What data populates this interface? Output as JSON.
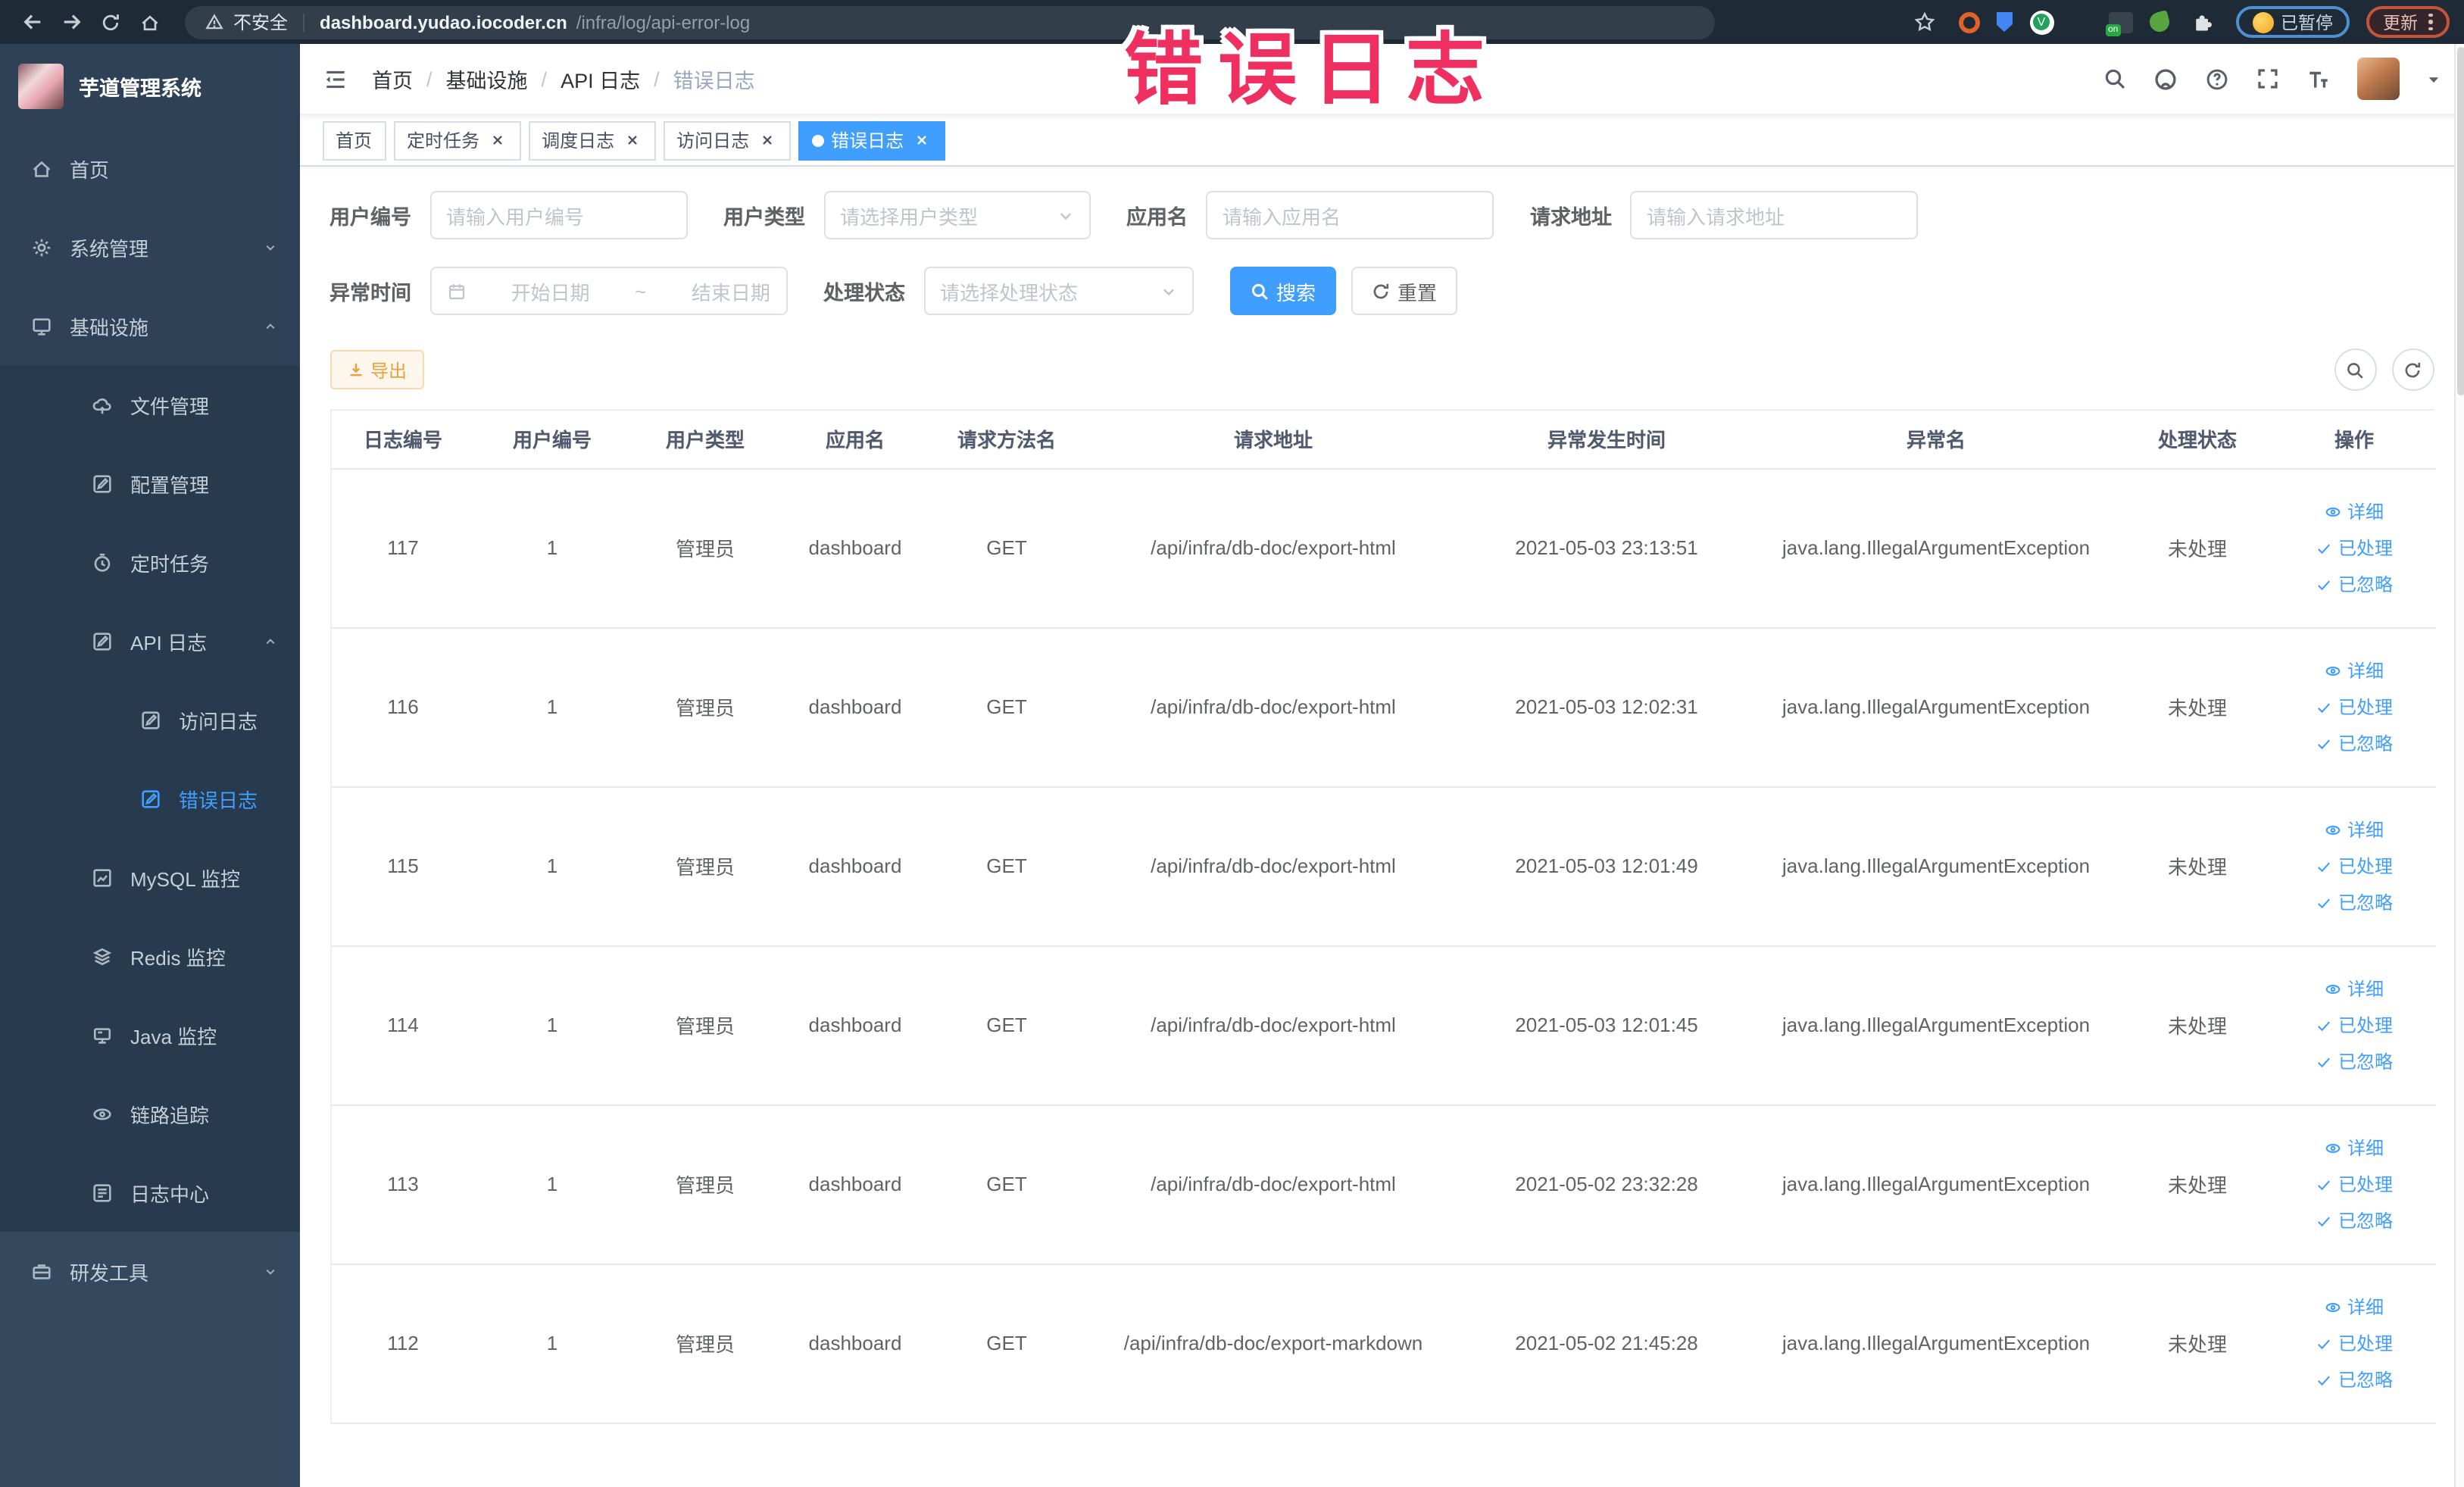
{
  "browser": {
    "security_label": "不安全",
    "url_host": "dashboard.yudao.iocoder.cn",
    "url_path": "/infra/log/api-error-log",
    "paused_label": "已暂停",
    "update_label": "更新"
  },
  "annotation": {
    "text": "错误日志",
    "color": "#ee2f5f"
  },
  "sidebar": {
    "logo_title": "芋道管理系统",
    "menu": [
      {
        "label": "首页",
        "icon": "home",
        "level": 1,
        "section": "top"
      },
      {
        "label": "系统管理",
        "icon": "gear",
        "level": 1,
        "section": "top",
        "chevron": "down"
      },
      {
        "label": "基础设施",
        "icon": "monitor",
        "level": 1,
        "section": "top",
        "chevron": "up"
      },
      {
        "label": "文件管理",
        "icon": "cloud",
        "level": 2,
        "section": "sub"
      },
      {
        "label": "配置管理",
        "icon": "edit",
        "level": 2,
        "section": "sub"
      },
      {
        "label": "定时任务",
        "icon": "timer",
        "level": 2,
        "section": "sub"
      },
      {
        "label": "API 日志",
        "icon": "edit",
        "level": 2,
        "section": "sub",
        "chevron": "up"
      },
      {
        "label": "访问日志",
        "icon": "edit",
        "level": 3,
        "section": "sub"
      },
      {
        "label": "错误日志",
        "icon": "edit",
        "level": 3,
        "section": "sub",
        "active": true
      },
      {
        "label": "MySQL 监控",
        "icon": "chart",
        "level": 2,
        "section": "sub"
      },
      {
        "label": "Redis 监控",
        "icon": "layers",
        "level": 2,
        "section": "sub"
      },
      {
        "label": "Java 监控",
        "icon": "java",
        "level": 2,
        "section": "sub"
      },
      {
        "label": "链路追踪",
        "icon": "eye",
        "level": 2,
        "section": "sub"
      },
      {
        "label": "日志中心",
        "icon": "doc",
        "level": 2,
        "section": "sub"
      },
      {
        "label": "研发工具",
        "icon": "tools",
        "level": 1,
        "section": "bottom",
        "chevron": "down"
      }
    ]
  },
  "breadcrumb": {
    "items": [
      "首页",
      "基础设施",
      "API 日志"
    ],
    "current": "错误日志"
  },
  "tabs": [
    {
      "label": "首页",
      "closable": false,
      "active": false
    },
    {
      "label": "定时任务",
      "closable": true,
      "active": false
    },
    {
      "label": "调度日志",
      "closable": true,
      "active": false
    },
    {
      "label": "访问日志",
      "closable": true,
      "active": false
    },
    {
      "label": "错误日志",
      "closable": true,
      "active": true
    }
  ],
  "filters": {
    "user_id": {
      "label": "用户编号",
      "placeholder": "请输入用户编号"
    },
    "user_type": {
      "label": "用户类型",
      "placeholder": "请选择用户类型"
    },
    "app_name": {
      "label": "应用名",
      "placeholder": "请输入应用名"
    },
    "request_url": {
      "label": "请求地址",
      "placeholder": "请输入请求地址"
    },
    "exception_time": {
      "label": "异常时间",
      "start_placeholder": "开始日期",
      "separator": "~",
      "end_placeholder": "结束日期"
    },
    "process_status": {
      "label": "处理状态",
      "placeholder": "请选择处理状态"
    },
    "search_label": "搜索",
    "reset_label": "重置"
  },
  "toolbar": {
    "export_label": "导出"
  },
  "table": {
    "columns": [
      "日志编号",
      "用户编号",
      "用户类型",
      "应用名",
      "请求方法名",
      "请求地址",
      "异常发生时间",
      "异常名",
      "处理状态",
      "操作"
    ],
    "rows": [
      {
        "id": "117",
        "user_id": "1",
        "user_type": "管理员",
        "app": "dashboard",
        "method": "GET",
        "url": "/api/infra/db-doc/export-html",
        "time": "2021-05-03 23:13:51",
        "exception": "java.lang.IllegalArgumentException",
        "status": "未处理"
      },
      {
        "id": "116",
        "user_id": "1",
        "user_type": "管理员",
        "app": "dashboard",
        "method": "GET",
        "url": "/api/infra/db-doc/export-html",
        "time": "2021-05-03 12:02:31",
        "exception": "java.lang.IllegalArgumentException",
        "status": "未处理"
      },
      {
        "id": "115",
        "user_id": "1",
        "user_type": "管理员",
        "app": "dashboard",
        "method": "GET",
        "url": "/api/infra/db-doc/export-html",
        "time": "2021-05-03 12:01:49",
        "exception": "java.lang.IllegalArgumentException",
        "status": "未处理"
      },
      {
        "id": "114",
        "user_id": "1",
        "user_type": "管理员",
        "app": "dashboard",
        "method": "GET",
        "url": "/api/infra/db-doc/export-html",
        "time": "2021-05-03 12:01:45",
        "exception": "java.lang.IllegalArgumentException",
        "status": "未处理"
      },
      {
        "id": "113",
        "user_id": "1",
        "user_type": "管理员",
        "app": "dashboard",
        "method": "GET",
        "url": "/api/infra/db-doc/export-html",
        "time": "2021-05-02 23:32:28",
        "exception": "java.lang.IllegalArgumentException",
        "status": "未处理"
      },
      {
        "id": "112",
        "user_id": "1",
        "user_type": "管理员",
        "app": "dashboard",
        "method": "GET",
        "url": "/api/infra/db-doc/export-markdown",
        "time": "2021-05-02 21:45:28",
        "exception": "java.lang.IllegalArgumentException",
        "status": "未处理"
      }
    ],
    "row_actions": [
      {
        "label": "详细",
        "icon": "eye-icon"
      },
      {
        "label": "已处理",
        "icon": "check-icon"
      },
      {
        "label": "已忽略",
        "icon": "check-icon"
      }
    ]
  },
  "colors": {
    "primary": "#409eff",
    "warning": "#e6a23c",
    "sidebar_bg": "#2e4156",
    "submenu_bg": "#273a4e"
  }
}
